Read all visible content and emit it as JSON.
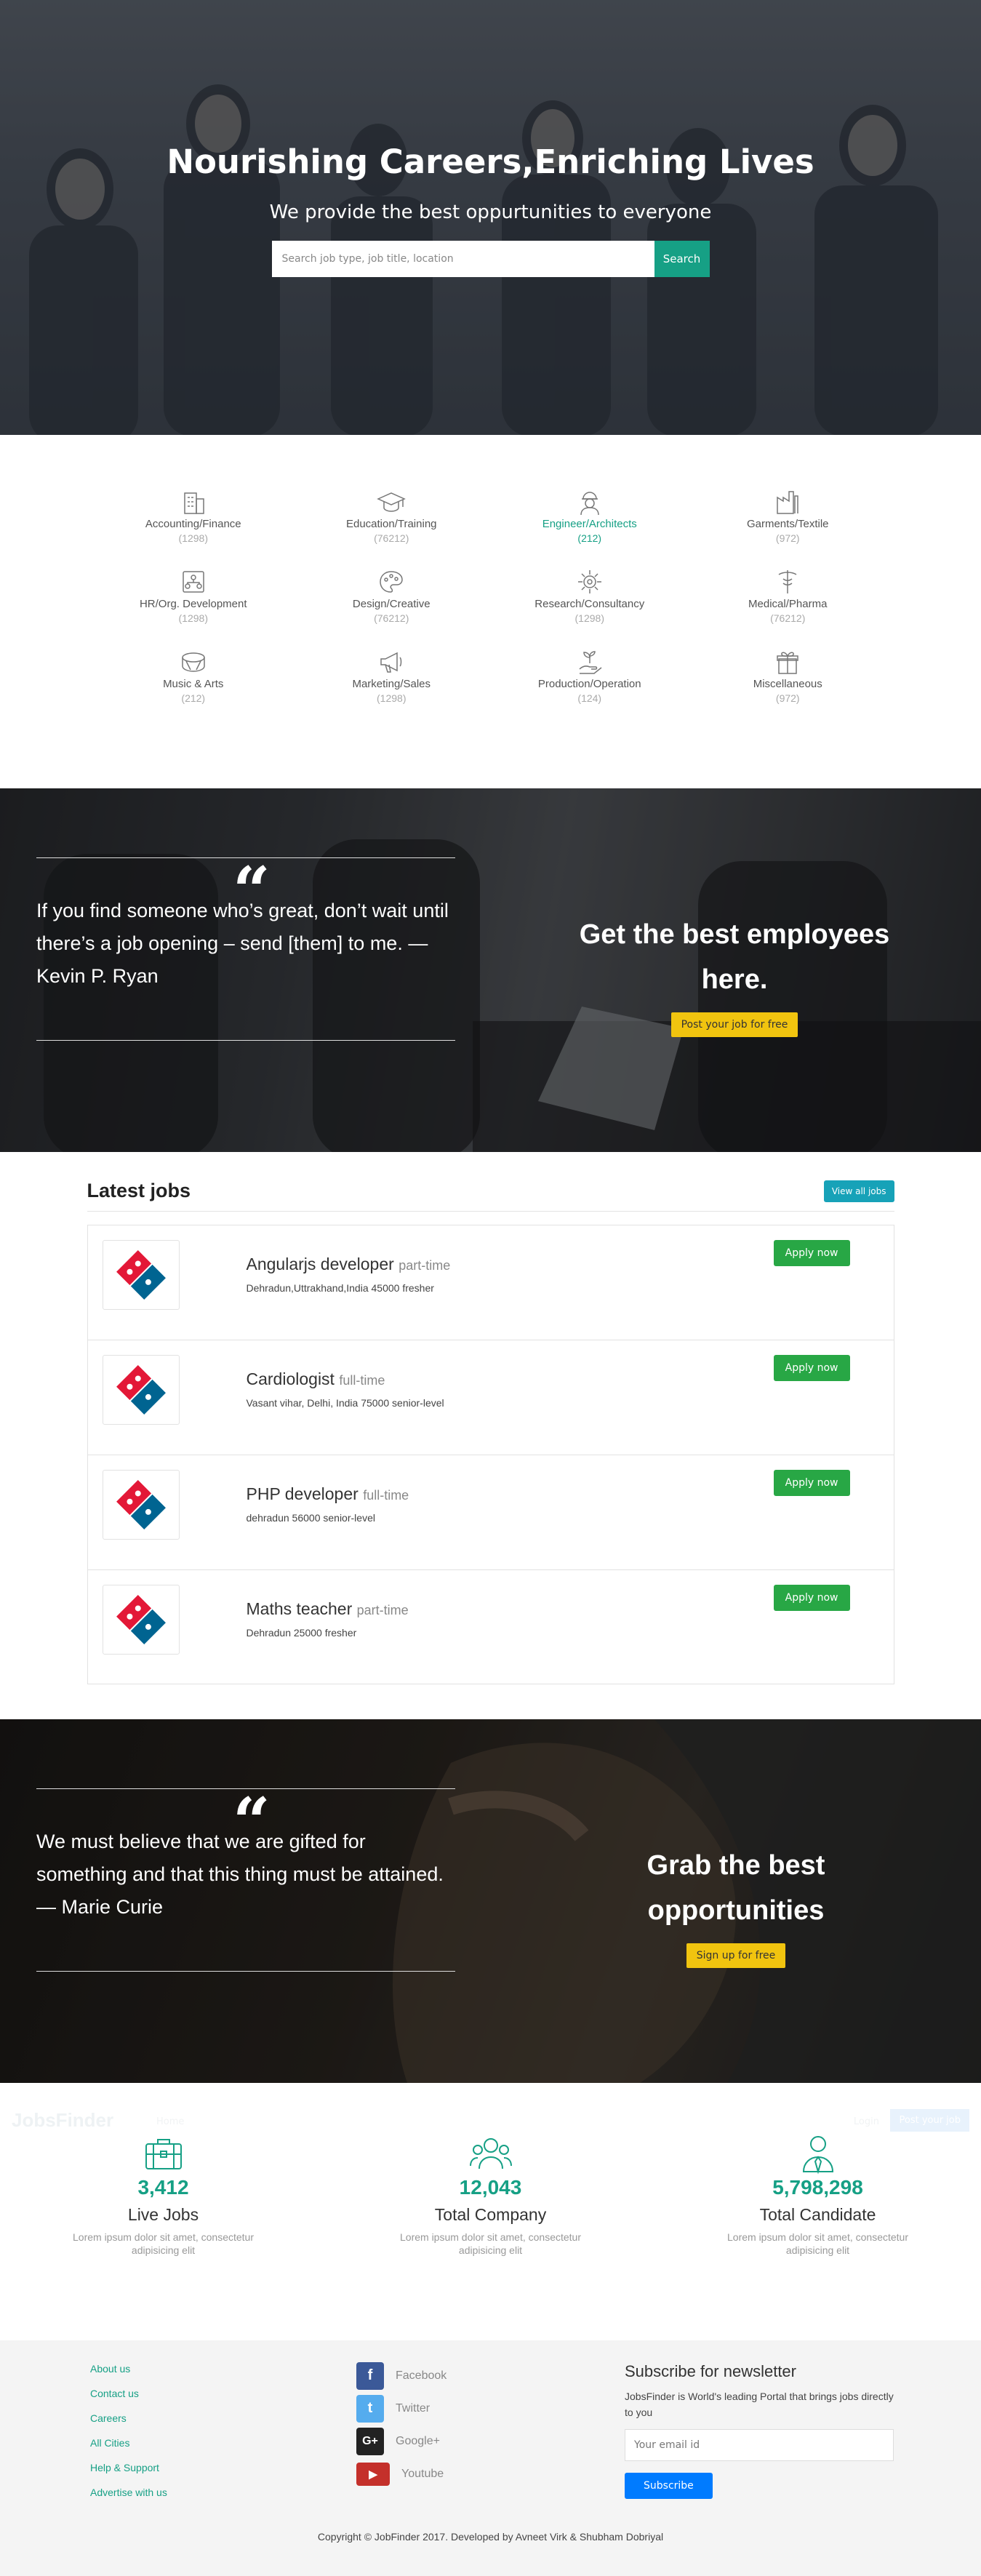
{
  "hero": {
    "title": "Nourishing Careers,Enriching Lives",
    "subtitle": "We provide the best oppurtunities to everyone",
    "search_placeholder": "Search job type, job title, location",
    "search_button": "Search"
  },
  "categories": [
    {
      "name": "Accounting/Finance",
      "count": "(1298)",
      "icon": "building-icon"
    },
    {
      "name": "Education/Training",
      "count": "(76212)",
      "icon": "graduation-cap-icon"
    },
    {
      "name": "Engineer/Architects",
      "count": "(212)",
      "icon": "engineer-icon"
    },
    {
      "name": "Garments/Textile",
      "count": "(972)",
      "icon": "factory-icon"
    },
    {
      "name": "HR/Org. Development",
      "count": "(1298)",
      "icon": "org-chart-icon"
    },
    {
      "name": "Design/Creative",
      "count": "(76212)",
      "icon": "palette-icon"
    },
    {
      "name": "Research/Consultancy",
      "count": "(1298)",
      "icon": "research-icon"
    },
    {
      "name": "Medical/Pharma",
      "count": "(76212)",
      "icon": "medical-icon"
    },
    {
      "name": "Music & Arts",
      "count": "(212)",
      "icon": "drum-icon"
    },
    {
      "name": "Marketing/Sales",
      "count": "(1298)",
      "icon": "megaphone-icon"
    },
    {
      "name": "Production/Operation",
      "count": "(124)",
      "icon": "plant-hand-icon"
    },
    {
      "name": "Miscellaneous",
      "count": "(972)",
      "icon": "gift-icon"
    }
  ],
  "banner1": {
    "quote": "If you find someone who’s great, don’t wait until there’s a job opening – send [them] to me. — Kevin P. Ryan",
    "cta_title": "Get the best employees here.",
    "cta_button": "Post your job for free"
  },
  "jobs": {
    "title": "Latest jobs",
    "view_all": "View all jobs",
    "apply_label": "Apply now",
    "items": [
      {
        "title": "Angularjs developer",
        "type": "part-time",
        "meta": "Dehradun,Uttrakhand,India 45000 fresher"
      },
      {
        "title": "Cardiologist",
        "type": "full-time",
        "meta": "Vasant vihar, Delhi, India 75000 senior-level"
      },
      {
        "title": "PHP developer",
        "type": "full-time",
        "meta": "dehradun 56000 senior-level"
      },
      {
        "title": "Maths teacher",
        "type": "part-time",
        "meta": "Dehradun 25000 fresher"
      }
    ]
  },
  "banner2": {
    "quote": "We must believe that we are gifted for something and that this thing must be attained. — Marie Curie",
    "cta_title": "Grab the best opportunities",
    "cta_button": "Sign up for free"
  },
  "ghost_nav": {
    "brand": "JobsFinder",
    "link": "Home",
    "login": "Login",
    "post": "Post your job"
  },
  "stats": [
    {
      "number": "3,412",
      "label": "Live Jobs",
      "desc": "Lorem ipsum dolor sit amet, consectetur adipisicing elit",
      "icon": "briefcase-icon"
    },
    {
      "number": "12,043",
      "label": "Total Company",
      "desc": "Lorem ipsum dolor sit amet, consectetur adipisicing elit",
      "icon": "team-icon"
    },
    {
      "number": "5,798,298",
      "label": "Total Candidate",
      "desc": "Lorem ipsum dolor sit amet, consectetur adipisicing elit",
      "icon": "candidate-icon"
    }
  ],
  "footer": {
    "links": [
      "About us",
      "Contact us",
      "Careers",
      "All Cities",
      "Help & Support",
      "Advertise with us"
    ],
    "social": [
      {
        "name": "Facebook",
        "icon": "facebook-icon",
        "color": "#3b5998",
        "glyph": "f"
      },
      {
        "name": "Twitter",
        "icon": "twitter-icon",
        "color": "#55acee",
        "glyph": "t"
      },
      {
        "name": "Google+",
        "icon": "google-plus-icon",
        "color": "#222222",
        "glyph": "G+"
      },
      {
        "name": "Youtube",
        "icon": "youtube-icon",
        "color": "#c4302b",
        "glyph": "▶"
      }
    ],
    "newsletter_title": "Subscribe for newsletter",
    "newsletter_desc": "JobsFinder is World's leading Portal that brings jobs directly to you",
    "email_placeholder": "Your email id",
    "subscribe": "Subscribe",
    "copyright": "Copyright © JobFinder 2017. Developed by Avneet Virk & Shubham Dobriyal"
  },
  "colors": {
    "accent": "#16a085",
    "apply": "#28a745",
    "cta": "#f1c40f",
    "info": "#17a2b8",
    "primary": "#007bff"
  }
}
